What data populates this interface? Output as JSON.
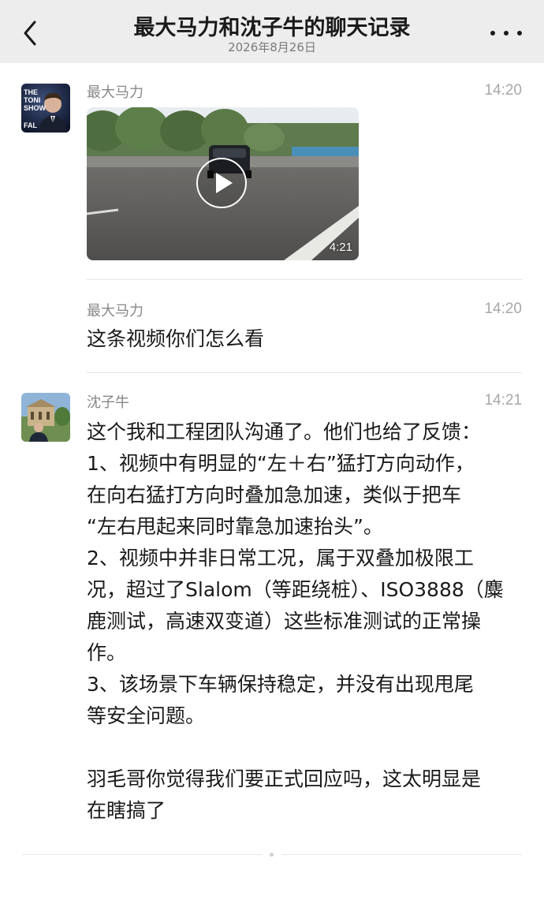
{
  "header": {
    "title": "最大马力和沈子牛的聊天记录",
    "date": "2026年8月26日",
    "back_icon": "chevron-left-icon",
    "more_icon": "ellipsis-icon"
  },
  "messages": [
    {
      "sender": "最大马力",
      "time": "14:20",
      "type": "video",
      "video_duration": "4:21",
      "avatar_text": [
        "THE",
        "TONI",
        "SHOW",
        "FAL"
      ]
    },
    {
      "sender": "最大马力",
      "time": "14:20",
      "type": "text",
      "text": "这条视频你们怎么看"
    },
    {
      "sender": "沈子牛",
      "time": "14:21",
      "type": "text",
      "lines": [
        "这个我和工程团队沟通了。他们也给了反馈：",
        "1、视频中有明显的“左＋右”猛打方向动作，",
        "在向右猛打方向时叠加急加速，类似于把车",
        "“左右甩起来同时靠急加速抬头”。",
        "2、视频中并非日常工况，属于双叠加极限工",
        "况，超过了Slalom（等距绕桩）、ISO3888（麋",
        "鹿测试，高速双变道）这些标准测试的正常操",
        "作。",
        "3、该场景下车辆保持稳定，并没有出现甩尾",
        "等安全问题。",
        "",
        "羽毛哥你觉得我们要正式回应吗，这太明显是",
        "在瞎搞了"
      ]
    }
  ],
  "colors": {
    "header_bg": "#ededed",
    "sender": "#888888",
    "time": "#a8a8a8",
    "divider": "#e5e5e5"
  }
}
